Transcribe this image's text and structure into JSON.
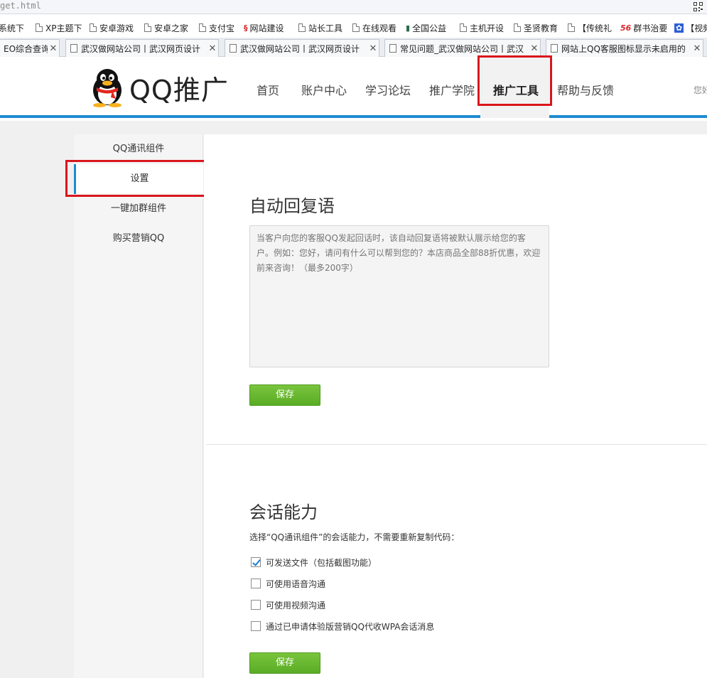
{
  "browser": {
    "url": "get.html",
    "bookmarks": [
      {
        "label": "系统下",
        "icon": "page-icon"
      },
      {
        "label": "XP主题下",
        "icon": "page-icon"
      },
      {
        "label": "安卓游戏",
        "icon": "page-icon"
      },
      {
        "label": "安卓之家",
        "icon": "page-icon"
      },
      {
        "label": "支付宝",
        "icon": "page-icon"
      },
      {
        "label": "网站建设",
        "icon": "site-icon-red"
      },
      {
        "label": "站长工具",
        "icon": "page-icon"
      },
      {
        "label": "在线观看",
        "icon": "page-icon"
      },
      {
        "label": "全国公益",
        "icon": "site-icon-green"
      },
      {
        "label": "主机开设",
        "icon": "page-icon"
      },
      {
        "label": "圣贤教育",
        "icon": "page-icon"
      },
      {
        "label": "【传统礼",
        "icon": "page-icon"
      },
      {
        "label": "群书治要",
        "icon": "site-icon-56"
      },
      {
        "label": "【视频",
        "icon": "paw-icon"
      }
    ],
    "tabs": [
      {
        "title": "EO综合查询"
      },
      {
        "title": "武汉做网站公司丨武汉网页设计"
      },
      {
        "title": "武汉做网站公司丨武汉网页设计"
      },
      {
        "title": "常见问题_武汉做网站公司丨武汉"
      },
      {
        "title": "网站上QQ客服图标显示未启用的"
      }
    ]
  },
  "header": {
    "brand": "QQ推广",
    "nav": [
      "首页",
      "账户中心",
      "学习论坛",
      "推广学院",
      "推广工具",
      "帮助与反馈"
    ],
    "active_nav": "推广工具",
    "greeting": "您好"
  },
  "sidebar": {
    "items": [
      {
        "label": "QQ通讯组件",
        "active": false
      },
      {
        "label": "设置",
        "active": true
      },
      {
        "label": "一键加群组件",
        "active": false
      },
      {
        "label": "购买营销QQ",
        "active": false
      }
    ]
  },
  "auto_reply": {
    "title": "自动回复语",
    "placeholder": "当客户向您的客服QQ发起回话时，该自动回复语将被默认展示给您的客户。例如：您好，请问有什么可以帮到您的？本店商品全部88折优惠，欢迎前来咨询！（最多200字）",
    "save_label": "保存"
  },
  "session": {
    "title": "会话能力",
    "description": "选择“QQ通讯组件”的会话能力，不需要重新复制代码：",
    "options": [
      {
        "label": "可发送文件（包括截图功能）",
        "checked": true
      },
      {
        "label": "可使用语音沟通",
        "checked": false
      },
      {
        "label": "可使用视频沟通",
        "checked": false
      },
      {
        "label": "通过已申请体验版营销QQ代收WPA会话消息",
        "checked": false
      }
    ],
    "save_label": "保存"
  },
  "colors": {
    "accent": "#1e8bd0",
    "highlight": "#d9161c",
    "button": "#6ab832"
  }
}
